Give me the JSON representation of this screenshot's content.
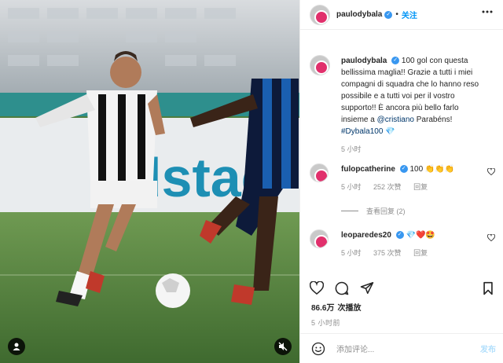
{
  "header": {
    "username": "paulodybala",
    "separator": "•",
    "follow_label": "关注"
  },
  "caption": {
    "username": "paulodybala",
    "text": "100 gol con questa bellissima maglia!! Grazie a tutti i miei compagni di squadra che lo hanno reso possibile e a tutti voi per il vostro supporto!! È ancora più bello farlo insieme a",
    "mention": "@cristiano",
    "text_after": "Parabéns!",
    "hashtag": "#Dybala100",
    "hashtag_emoji": "💎",
    "time": "5 小时"
  },
  "comments": [
    {
      "username": "fulopcatherine",
      "text": "100 👏👏👏",
      "time": "5 小时",
      "likes": "252 次赞",
      "reply": "回复",
      "view_replies": "查看回复 (2)"
    },
    {
      "username": "leoparedes20",
      "text": "💎❤️🤩",
      "time": "5 小时",
      "likes": "375 次赞",
      "reply": "回复"
    }
  ],
  "post": {
    "views": "86.6万",
    "views_suffix": "次播放",
    "time": "5 小时前",
    "comment_placeholder": "添加评论...",
    "post_label": "发布"
  },
  "icons": {
    "like": "heart-icon",
    "comment": "comment-icon",
    "share": "share-icon",
    "save": "bookmark-icon",
    "emoji": "emoji-icon",
    "more": "more-icon",
    "mute": "mute-icon",
    "user_tag": "user-tag-icon"
  },
  "colors": {
    "accent": "#0095f6",
    "verified": "#3897f0",
    "muted_text": "#8e8e8e"
  }
}
